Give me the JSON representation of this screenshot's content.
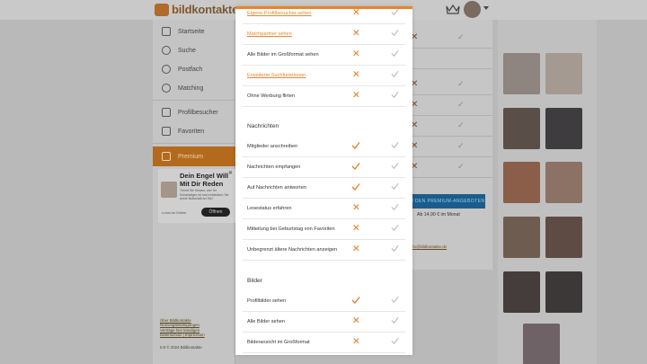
{
  "brand": {
    "name_prefix": "bild",
    "name_suffix": "kontakte"
  },
  "nav": [
    {
      "label": "Startseite",
      "icon": "home-icon"
    },
    {
      "label": "Suche",
      "icon": "search-icon"
    },
    {
      "label": "Postfach",
      "icon": "chat-icon"
    },
    {
      "label": "Matching",
      "icon": "heart-chat-icon"
    },
    {
      "label": "Profilbesucher",
      "icon": "binoculars-icon"
    },
    {
      "label": "Favoriten",
      "icon": "star-icon"
    },
    {
      "label": "Premium",
      "icon": "crown-icon"
    }
  ],
  "ad": {
    "title": "Dein Engel Will Mit Dir Reden",
    "text": "Timmt Sie heraus, wer Ihr Scharlatiger ist und entdecken Sie seine Botschaft an Sie!",
    "status": "Lucia ist Online",
    "cta": "Öffnen"
  },
  "footer_links": [
    "Über Bildkontakte",
    "Nutzungsbedingungen",
    "Verträge hier kündigen",
    "Datenschutz | Impressum"
  ],
  "footer_copy": "0.9 © 2024 Bildkontakte",
  "background_page": {
    "upgrade_button": "ZU DEN PREMIUM-ANGEBOTEN",
    "price": "Ab 14,90 € im Monat",
    "mail": "info@bildkontakte.de"
  },
  "modal": {
    "section1_rows": [
      {
        "label": "Eigene Profilbesucher sehen",
        "link": true,
        "premium": false
      },
      {
        "label": "Matchpartner sehen",
        "link": true,
        "premium": false
      },
      {
        "label": "Alle Bilder im Großformat sehen",
        "link": false,
        "premium": false
      },
      {
        "label": "Erweiterte Suchfunktionen",
        "link": true,
        "premium": false
      },
      {
        "label": "Ohne Werbung flirten",
        "link": false,
        "premium": false
      }
    ],
    "section2_title": "Nachrichten",
    "section2_rows": [
      {
        "label": "Mitglieder anschreiben",
        "premium": true
      },
      {
        "label": "Nachrichten empfangen",
        "premium": true
      },
      {
        "label": "Auf Nachrichten antworten",
        "premium": true
      },
      {
        "label": "Lesestatus erfahren",
        "premium": false
      },
      {
        "label": "Mitteilung bei Geburtstag von Favoriten",
        "premium": false
      },
      {
        "label": "Unbegrenzt ältere Nachrichten anzeigen",
        "premium": false
      }
    ],
    "section3_title": "Bilder",
    "section3_rows": [
      {
        "label": "Profilbilder sehen",
        "premium": true
      },
      {
        "label": "Alle Bilder sehen",
        "premium": false
      },
      {
        "label": "Bilderansicht im Großformat",
        "premium": false
      }
    ]
  },
  "colors": {
    "accent": "#f0821e",
    "check_gray": "#a8a8a8",
    "premium_nav": "#b46a1c"
  }
}
